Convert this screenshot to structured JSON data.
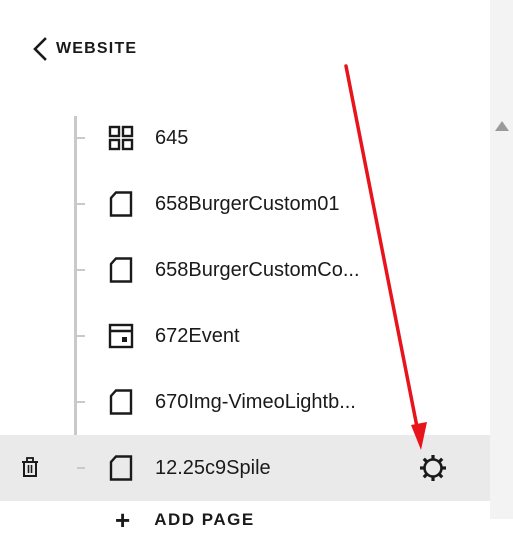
{
  "header": {
    "back_label": "WEBSITE"
  },
  "pages": [
    {
      "title": "645",
      "icon": "grid-icon"
    },
    {
      "title": "658BurgerCustom01",
      "icon": "page-icon"
    },
    {
      "title": "658BurgerCustomCo...",
      "icon": "page-icon"
    },
    {
      "title": "672Event",
      "icon": "event-icon"
    },
    {
      "title": "670Img-VimeoLightb...",
      "icon": "page-icon"
    },
    {
      "title": "12.25c9Spile",
      "icon": "page-icon",
      "selected": true
    }
  ],
  "footer": {
    "add_label": "ADD PAGE"
  },
  "annotation": {
    "arrow_color": "#e8141c"
  },
  "colors": {
    "selected_row": "#eaeaea",
    "tree_line": "#c9c9c9",
    "text": "#1a1a1a"
  }
}
